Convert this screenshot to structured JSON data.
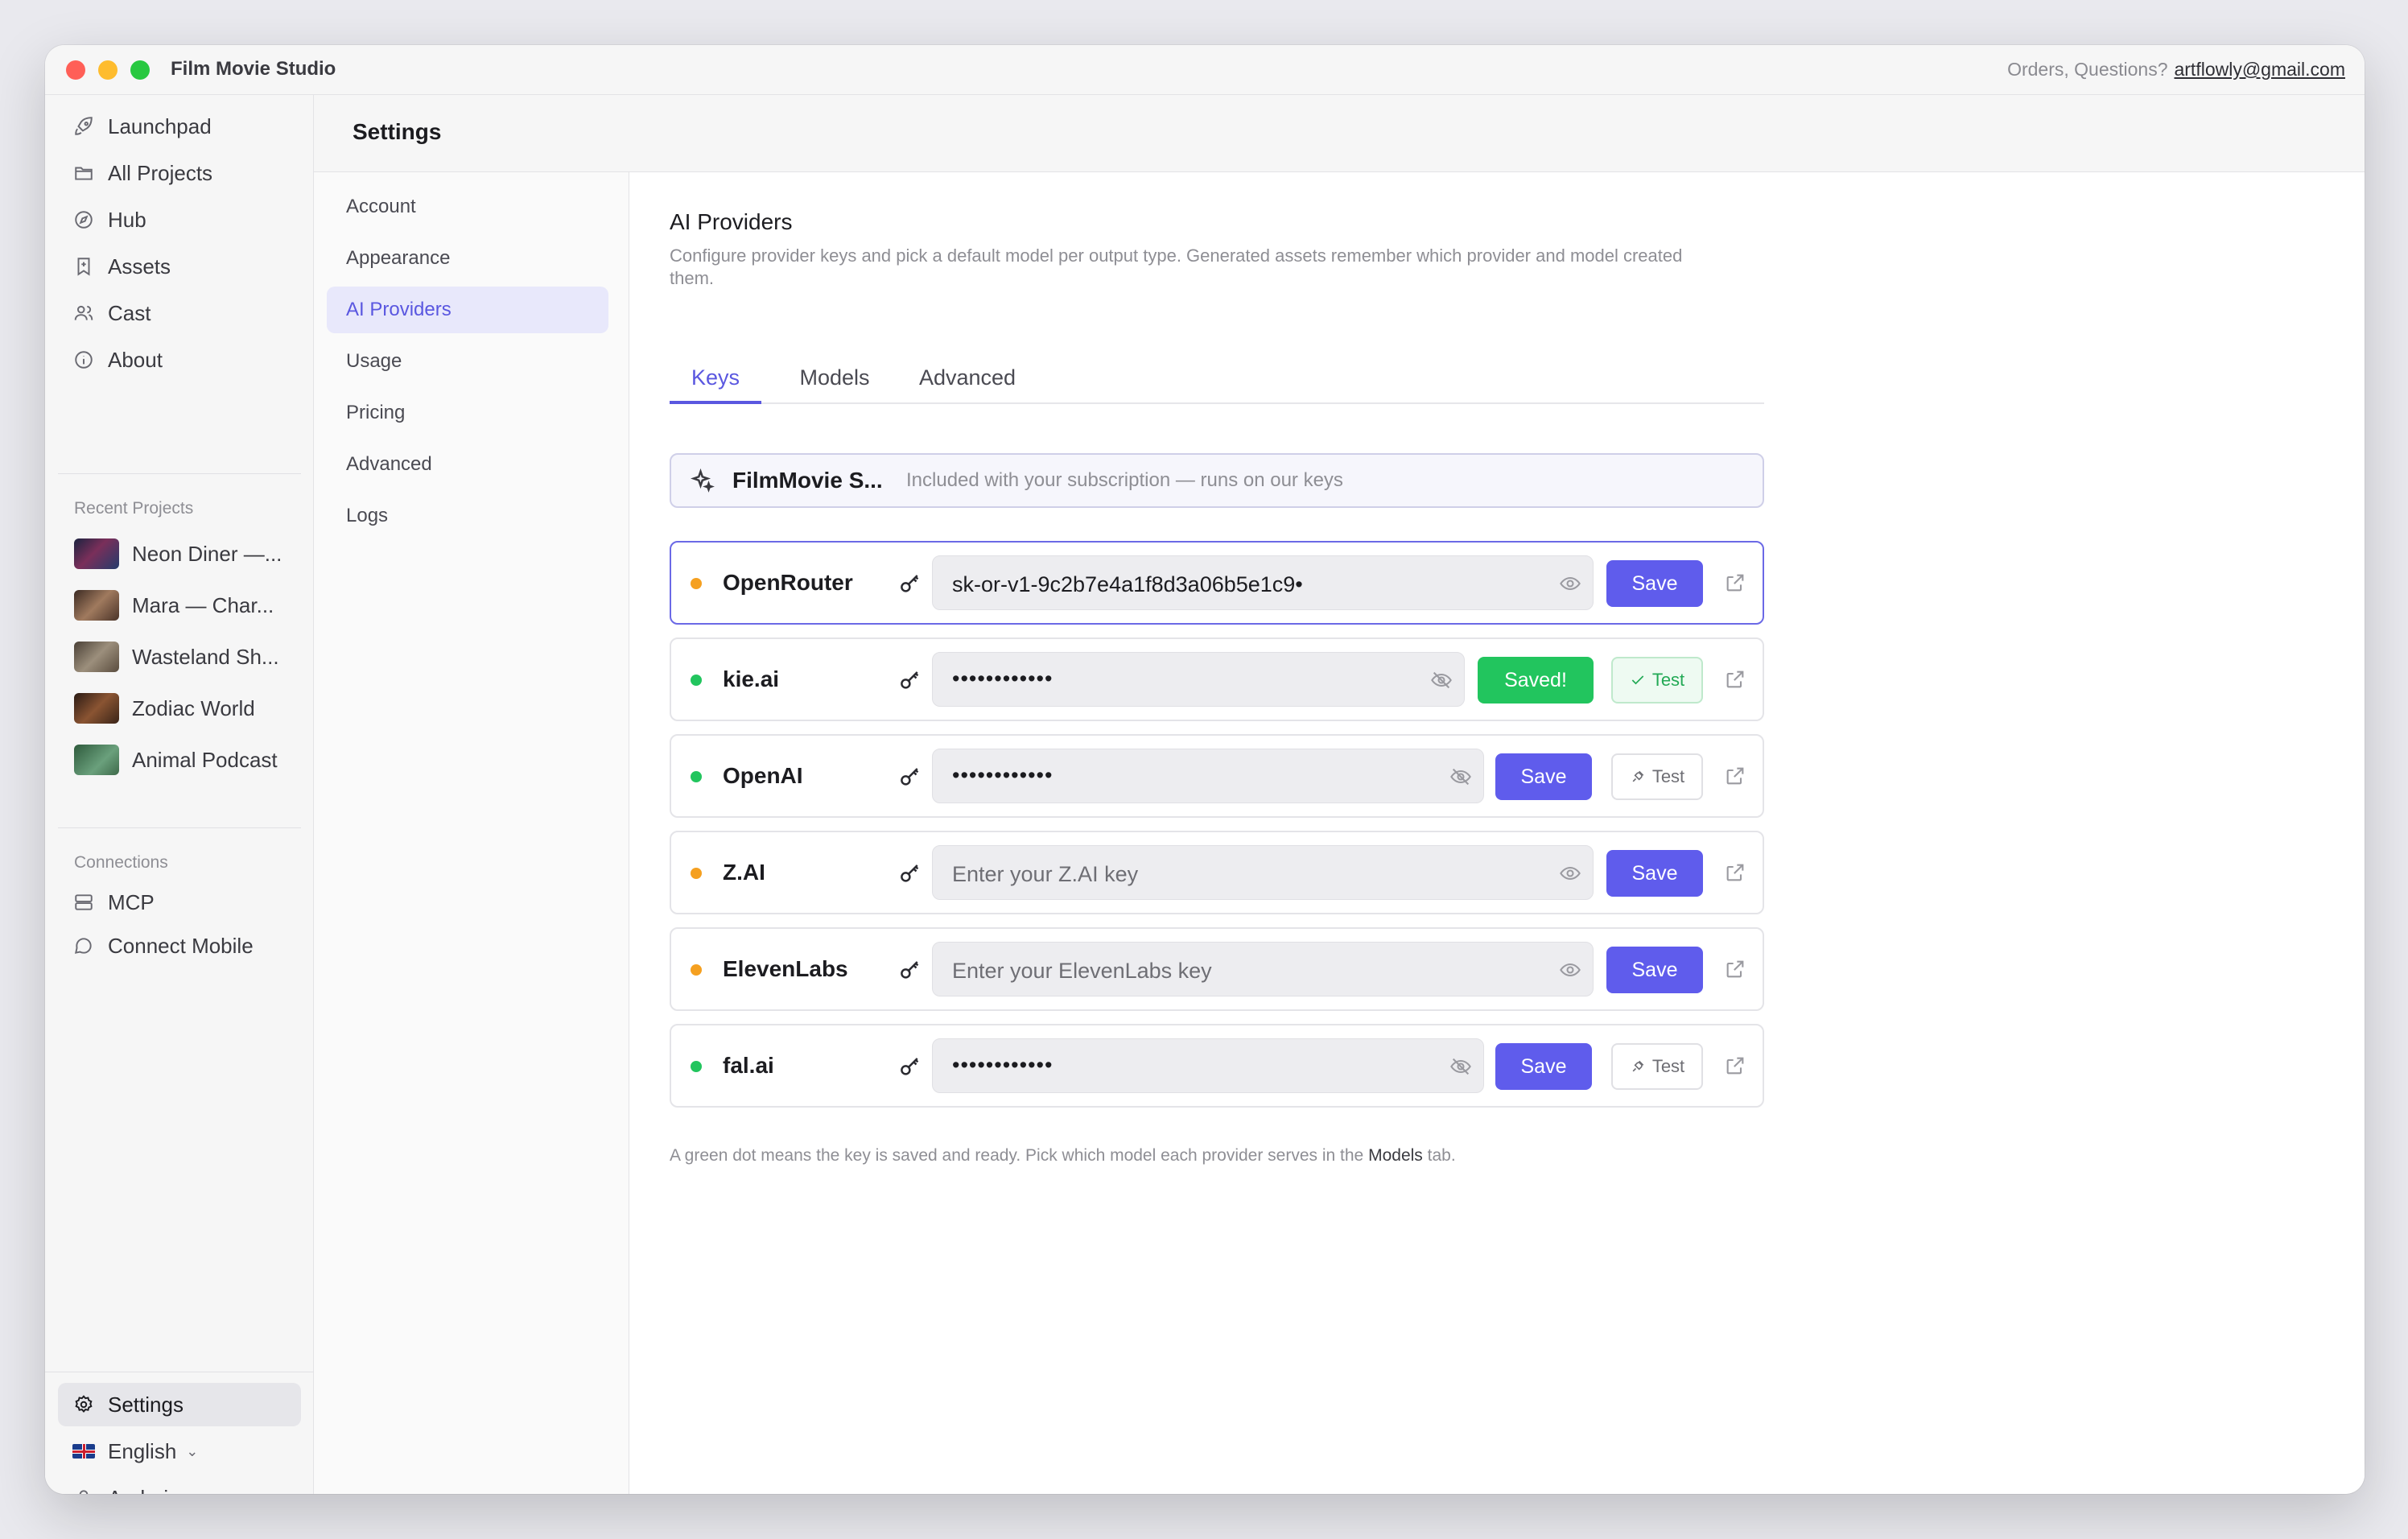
{
  "app": {
    "title": "Film Movie Studio"
  },
  "contact": {
    "prefix": "Orders, Questions?",
    "email": "artflowly@gmail.com"
  },
  "sidebar": {
    "nav": [
      {
        "label": "Launchpad",
        "icon": "rocket-icon"
      },
      {
        "label": "All Projects",
        "icon": "folder-icon"
      },
      {
        "label": "Hub",
        "icon": "compass-icon"
      },
      {
        "label": "Assets",
        "icon": "bookmark-icon"
      },
      {
        "label": "Cast",
        "icon": "users-icon"
      },
      {
        "label": "About",
        "icon": "info-icon"
      }
    ],
    "recent_label": "Recent Projects",
    "recent": [
      {
        "label": "Neon Diner —..."
      },
      {
        "label": "Mara — Char..."
      },
      {
        "label": "Wasteland Sh..."
      },
      {
        "label": "Zodiac World"
      },
      {
        "label": "Animal Podcast"
      }
    ],
    "connections_label": "Connections",
    "connections": [
      {
        "label": "MCP",
        "icon": "server-icon"
      },
      {
        "label": "Connect Mobile",
        "icon": "chat-bubble-icon"
      }
    ],
    "bottom": {
      "settings": "Settings",
      "language": "English",
      "user": "Andrej"
    }
  },
  "settings": {
    "title": "Settings",
    "subnav": [
      "Account",
      "Appearance",
      "AI Providers",
      "Usage",
      "Pricing",
      "Advanced",
      "Logs"
    ],
    "active_subnav": "AI Providers"
  },
  "content": {
    "heading": "AI Providers",
    "description": "Configure provider keys and pick a default model per output type. Generated assets remember which provider and model created them.",
    "tabs": [
      "Keys",
      "Models",
      "Advanced"
    ],
    "active_tab": "Keys",
    "studio": {
      "name": "FilmMovie S...",
      "note": "Included with your subscription — runs on our keys"
    },
    "providers": [
      {
        "name": "OpenRouter",
        "status": "orange",
        "value": "sk-or-v1-9c2b7e4a1f8d3a06b5e1c9•",
        "placeholder": "",
        "save": "Save",
        "test": ""
      },
      {
        "name": "kie.ai",
        "status": "green",
        "value": "••••••••••••",
        "placeholder": "",
        "save": "Saved!",
        "test": "Test"
      },
      {
        "name": "OpenAI",
        "status": "green",
        "value": "••••••••••••",
        "placeholder": "",
        "save": "Save",
        "test": "Test"
      },
      {
        "name": "Z.AI",
        "status": "orange",
        "value": "",
        "placeholder": "Enter your Z.AI key",
        "save": "Save",
        "test": ""
      },
      {
        "name": "ElevenLabs",
        "status": "orange",
        "value": "",
        "placeholder": "Enter your ElevenLabs key",
        "save": "Save",
        "test": ""
      },
      {
        "name": "fal.ai",
        "status": "green",
        "value": "••••••••••••",
        "placeholder": "",
        "save": "Save",
        "test": "Test"
      }
    ],
    "footer": {
      "before": "A green dot means the key is saved and ready. Pick which model each provider serves in the",
      "link": "Models",
      "after": "tab."
    }
  },
  "colors": {
    "accent": "#5f5cec",
    "success": "#22c55e",
    "pending": "#f5a020"
  }
}
